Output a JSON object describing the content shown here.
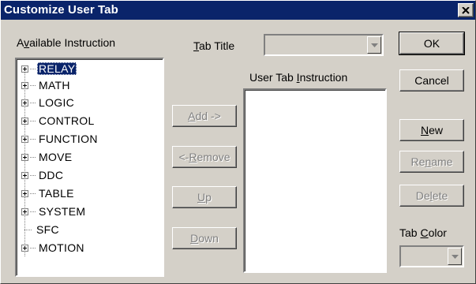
{
  "window": {
    "title": "Customize User Tab"
  },
  "labels": {
    "available_instruction": {
      "pre": "A",
      "u": "v",
      "post": "ailable Instruction"
    },
    "tab_title": {
      "pre": "",
      "u": "T",
      "post": "ab Title"
    },
    "user_tab_instruction": {
      "pre": "User Tab ",
      "u": "I",
      "post": "nstruction"
    },
    "tab_color": {
      "pre": "Tab ",
      "u": "C",
      "post": "olor"
    }
  },
  "tree": {
    "items": [
      {
        "label": "RELAY",
        "expandable": true,
        "selected": true
      },
      {
        "label": "MATH",
        "expandable": true
      },
      {
        "label": "LOGIC",
        "expandable": true
      },
      {
        "label": "CONTROL",
        "expandable": true
      },
      {
        "label": "FUNCTION",
        "expandable": true
      },
      {
        "label": "MOVE",
        "expandable": true
      },
      {
        "label": "DDC",
        "expandable": true
      },
      {
        "label": "TABLE",
        "expandable": true
      },
      {
        "label": "SYSTEM",
        "expandable": true
      },
      {
        "label": "SFC",
        "expandable": false
      },
      {
        "label": "MOTION",
        "expandable": true
      }
    ]
  },
  "buttons": {
    "add": {
      "u": "A",
      "post": "dd ->",
      "pre": ""
    },
    "remove": {
      "pre": "<-",
      "u": "R",
      "post": "emove"
    },
    "up": {
      "pre": "",
      "u": "U",
      "post": "p"
    },
    "down": {
      "pre": "",
      "u": "D",
      "post": "own"
    },
    "ok": {
      "label": "OK"
    },
    "cancel": {
      "label": "Cancel"
    },
    "new": {
      "pre": "",
      "u": "N",
      "post": "ew"
    },
    "rename": {
      "pre": "Re",
      "u": "n",
      "post": "ame"
    },
    "delete": {
      "pre": "De",
      "u": "l",
      "post": "ete"
    }
  },
  "colors": {
    "selection": "#0a246a",
    "face": "#d4d0c8",
    "titlebar": "#0a246a"
  }
}
